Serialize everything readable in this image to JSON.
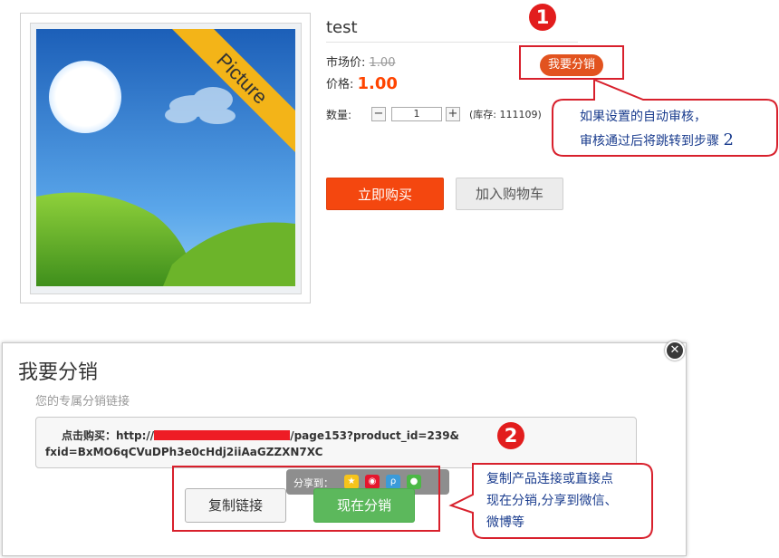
{
  "product": {
    "image_badge": "Picture",
    "title": "test",
    "market_price_label": "市场价:",
    "market_price": "1.00",
    "price_label": "价格:",
    "price": "1.00",
    "qty_label": "数量:",
    "qty_minus": "−",
    "qty_value": "1",
    "qty_plus": "+",
    "stock_text": "(库存: 111109)",
    "distribute_button": "我要分销",
    "buy_now_button": "立即购买",
    "add_to_cart_button": "加入购物车"
  },
  "annotations": {
    "step1_number": "1",
    "step1_text_line1": "如果设置的自动审核，",
    "step1_text_line2": "审核通过后将跳转到步骤",
    "step1_text_step": "2",
    "step2_number": "2",
    "step2_text_line1": "复制产品连接或直接点",
    "step2_text_line2": "现在分销,分享到微信、",
    "step2_text_line3": "微博等"
  },
  "dialog": {
    "title": "我要分销",
    "subtitle": "您的专属分销链接",
    "link_label": "点击购买：",
    "link_prefix": "http://",
    "link_suffix": "/page153?product_id=239&",
    "link_line2": "fxid=BxMO6qCVuDPh3e0cHdj2iiAaGZZXN7XC",
    "share_label": "分享到：",
    "share_icons": [
      "qzone-icon",
      "weibo-icon",
      "tencent-weibo-icon",
      "wechat-icon"
    ],
    "copy_button": "复制链接",
    "distribute_now_button": "现在分销",
    "close_symbol": "✕"
  },
  "colors": {
    "price": "#ff4400",
    "buy_button": "#f4470f",
    "distribute_button": "#e2531f",
    "distribute_now_button": "#5cb85c",
    "annotation_red": "#d8202c",
    "annotation_text": "#1a3c8e"
  }
}
